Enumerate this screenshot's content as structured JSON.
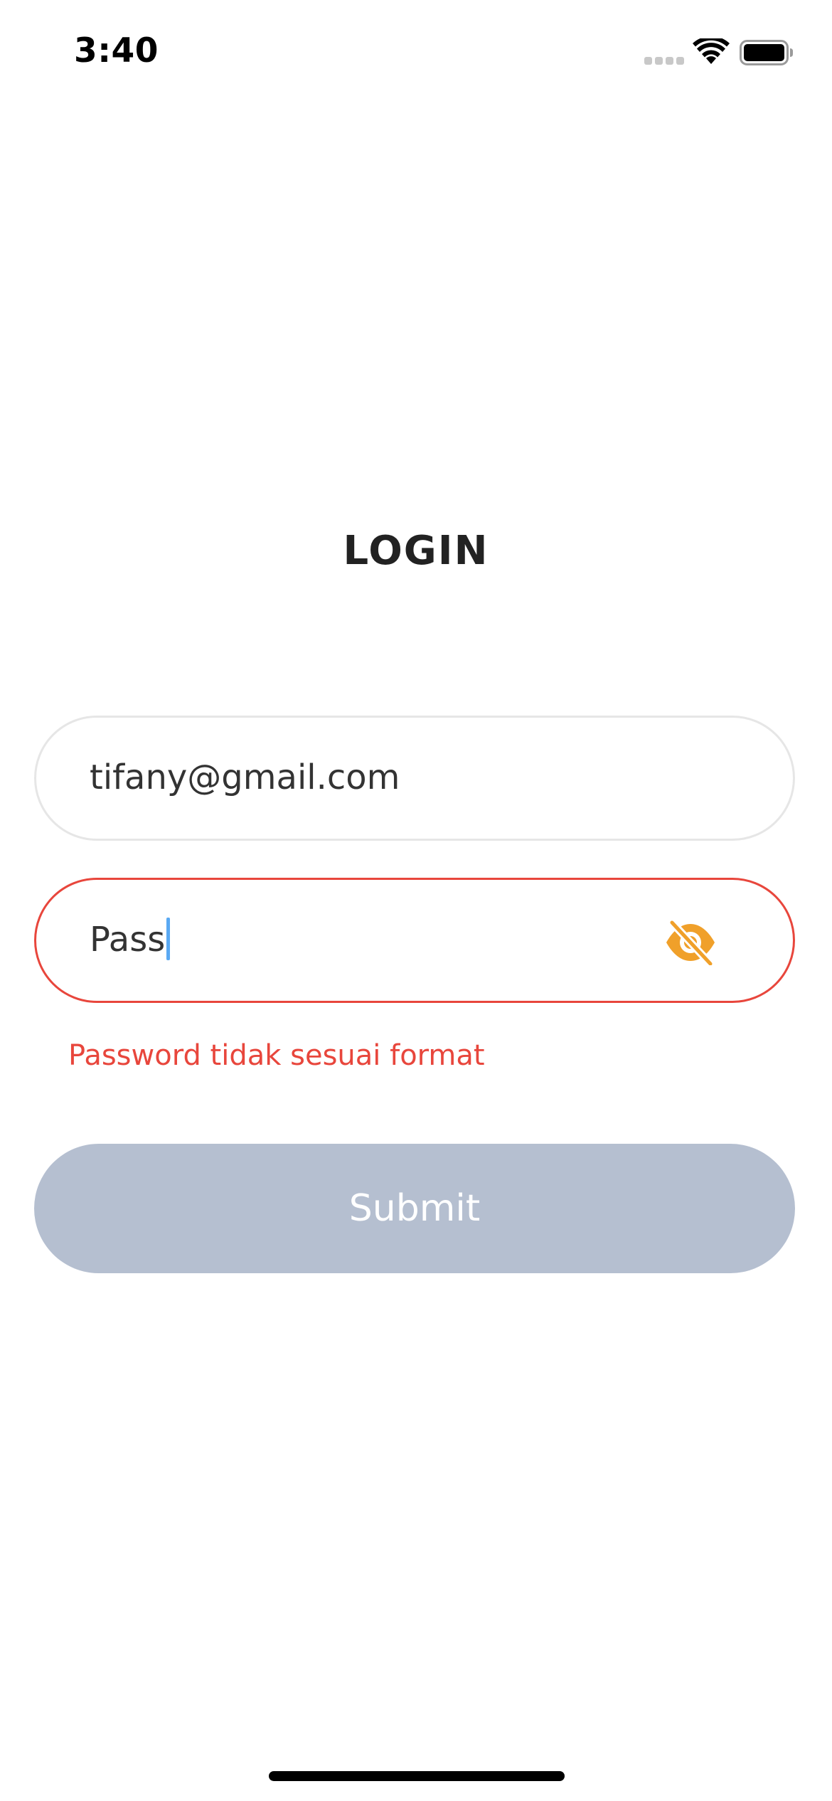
{
  "status_bar": {
    "time": "3:40",
    "icons": [
      "cellular-signal-icon",
      "wifi-icon",
      "battery-icon"
    ]
  },
  "login": {
    "title": "LOGIN",
    "email": {
      "value": "tifany@gmail.com"
    },
    "password": {
      "value": "Pass",
      "visibility_icon": "eye-off-icon",
      "state": "error"
    },
    "error_message": "Password tidak sesuai format",
    "submit_label": "Submit",
    "submit_enabled": false
  },
  "colors": {
    "error": "#e8463c",
    "accent_icon": "#f0a02a",
    "submit_disabled_bg": "#b5bfd0",
    "caret": "#5aa9f3",
    "input_border": "#e6e6e6"
  }
}
